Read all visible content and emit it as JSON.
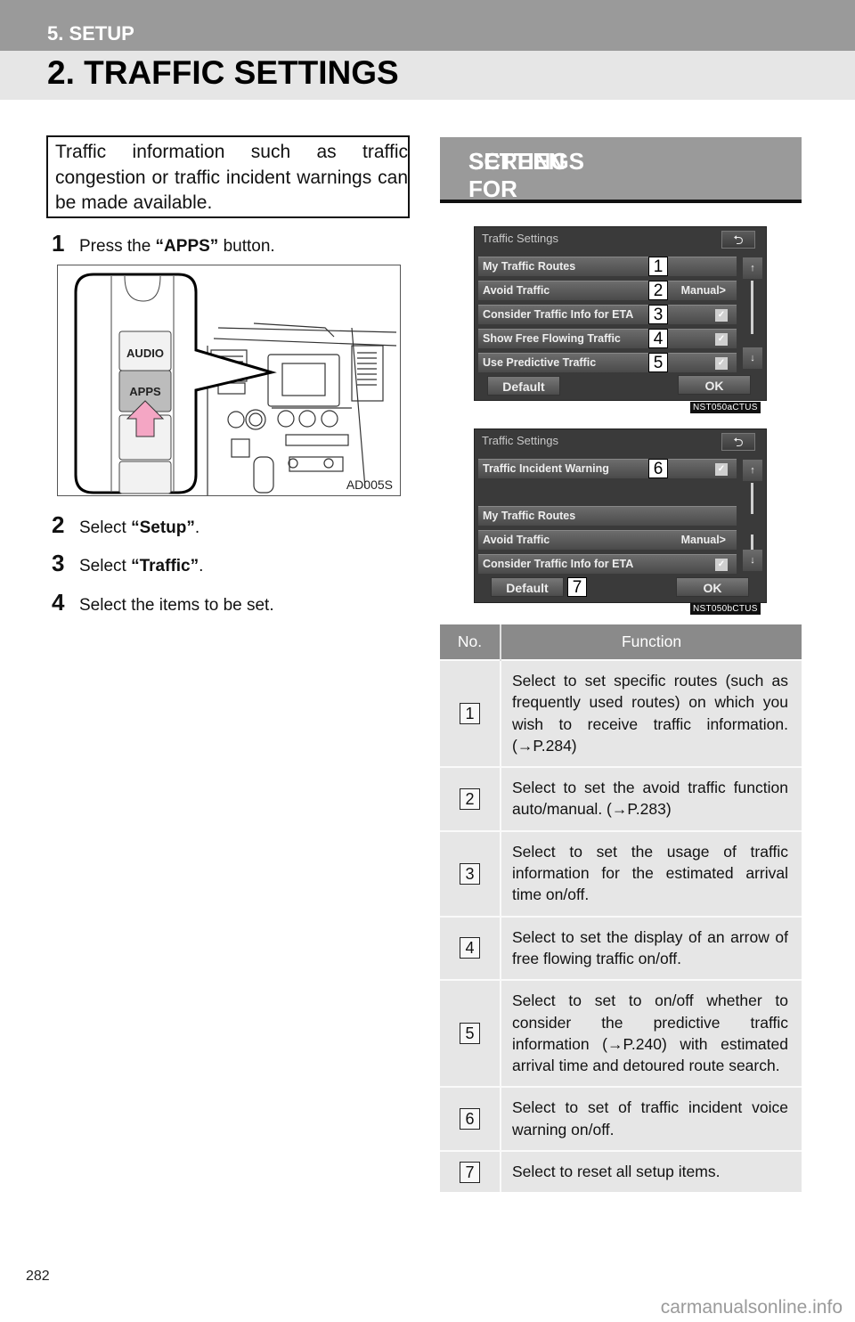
{
  "header": {
    "section": "5. SETUP",
    "title": "2. TRAFFIC SETTINGS"
  },
  "intro": "Traffic information such as traffic congestion or traffic incident warnings can be made available.",
  "steps": [
    {
      "num": "1",
      "pre": "Press the ",
      "bold": "“APPS”",
      "post": " button."
    },
    {
      "num": "2",
      "pre": "Select ",
      "bold": "“Setup”",
      "post": "."
    },
    {
      "num": "3",
      "pre": "Select ",
      "bold": "“Traffic”",
      "post": "."
    },
    {
      "num": "4",
      "pre": "Select the items to be set.",
      "bold": "",
      "post": ""
    }
  ],
  "illustration": {
    "code": "AD005S",
    "audio_label": "AUDIO",
    "apps_label": "APPS"
  },
  "screen_section": {
    "title_line1": "SCREEN FOR TRAFFIC",
    "title_line2": "SETTINGS"
  },
  "screen_a": {
    "title": "Traffic Settings",
    "back_icon": "back-arrow-icon",
    "rows": [
      {
        "label": "My Traffic Routes",
        "value": "",
        "checked": false,
        "callout": "1"
      },
      {
        "label": "Avoid Traffic",
        "value": "Manual>",
        "checked": false,
        "callout": "2"
      },
      {
        "label": "Consider Traffic Info for ETA",
        "value": "",
        "checked": true,
        "callout": "3"
      },
      {
        "label": "Show Free Flowing Traffic",
        "value": "",
        "checked": true,
        "callout": "4"
      },
      {
        "label": "Use Predictive Traffic",
        "value": "",
        "checked": true,
        "callout": "5"
      }
    ],
    "default_label": "Default",
    "ok_label": "OK",
    "code": "NST050aCTUS"
  },
  "screen_b": {
    "title": "Traffic Settings",
    "rows": [
      {
        "label": "Traffic Incident Warning",
        "value": "",
        "checked": true,
        "callout": "6"
      },
      {
        "label": "My Traffic Routes",
        "value": "",
        "checked": false,
        "callout": ""
      },
      {
        "label": "Avoid Traffic",
        "value": "Manual>",
        "checked": false,
        "callout": ""
      },
      {
        "label": "Consider Traffic Info for ETA",
        "value": "",
        "checked": true,
        "callout": ""
      }
    ],
    "default_label": "Default",
    "default_callout": "7",
    "ok_label": "OK",
    "code": "NST050bCTUS"
  },
  "table": {
    "headers": [
      "No.",
      "Function"
    ],
    "rows": [
      {
        "no": "1",
        "text": "Select to set specific routes (such as frequently used routes) on which you wish to receive traffic information. (→P.284)"
      },
      {
        "no": "2",
        "text": "Select to set the avoid traffic function auto/manual. (→P.283)"
      },
      {
        "no": "3",
        "text": "Select to set the usage of traffic information for the estimated arrival time on/off."
      },
      {
        "no": "4",
        "text": "Select to set the display of an arrow of free flowing traffic on/off."
      },
      {
        "no": "5",
        "text": "Select to set to on/off whether to consider the predictive traffic information (→P.240) with estimated arrival time and detoured route search."
      },
      {
        "no": "6",
        "text": "Select to set of traffic incident voice warning on/off."
      },
      {
        "no": "7",
        "text": "Select to reset all setup items."
      }
    ]
  },
  "footer": {
    "page_number": "282",
    "watermark": "carmanualsonline.info"
  }
}
